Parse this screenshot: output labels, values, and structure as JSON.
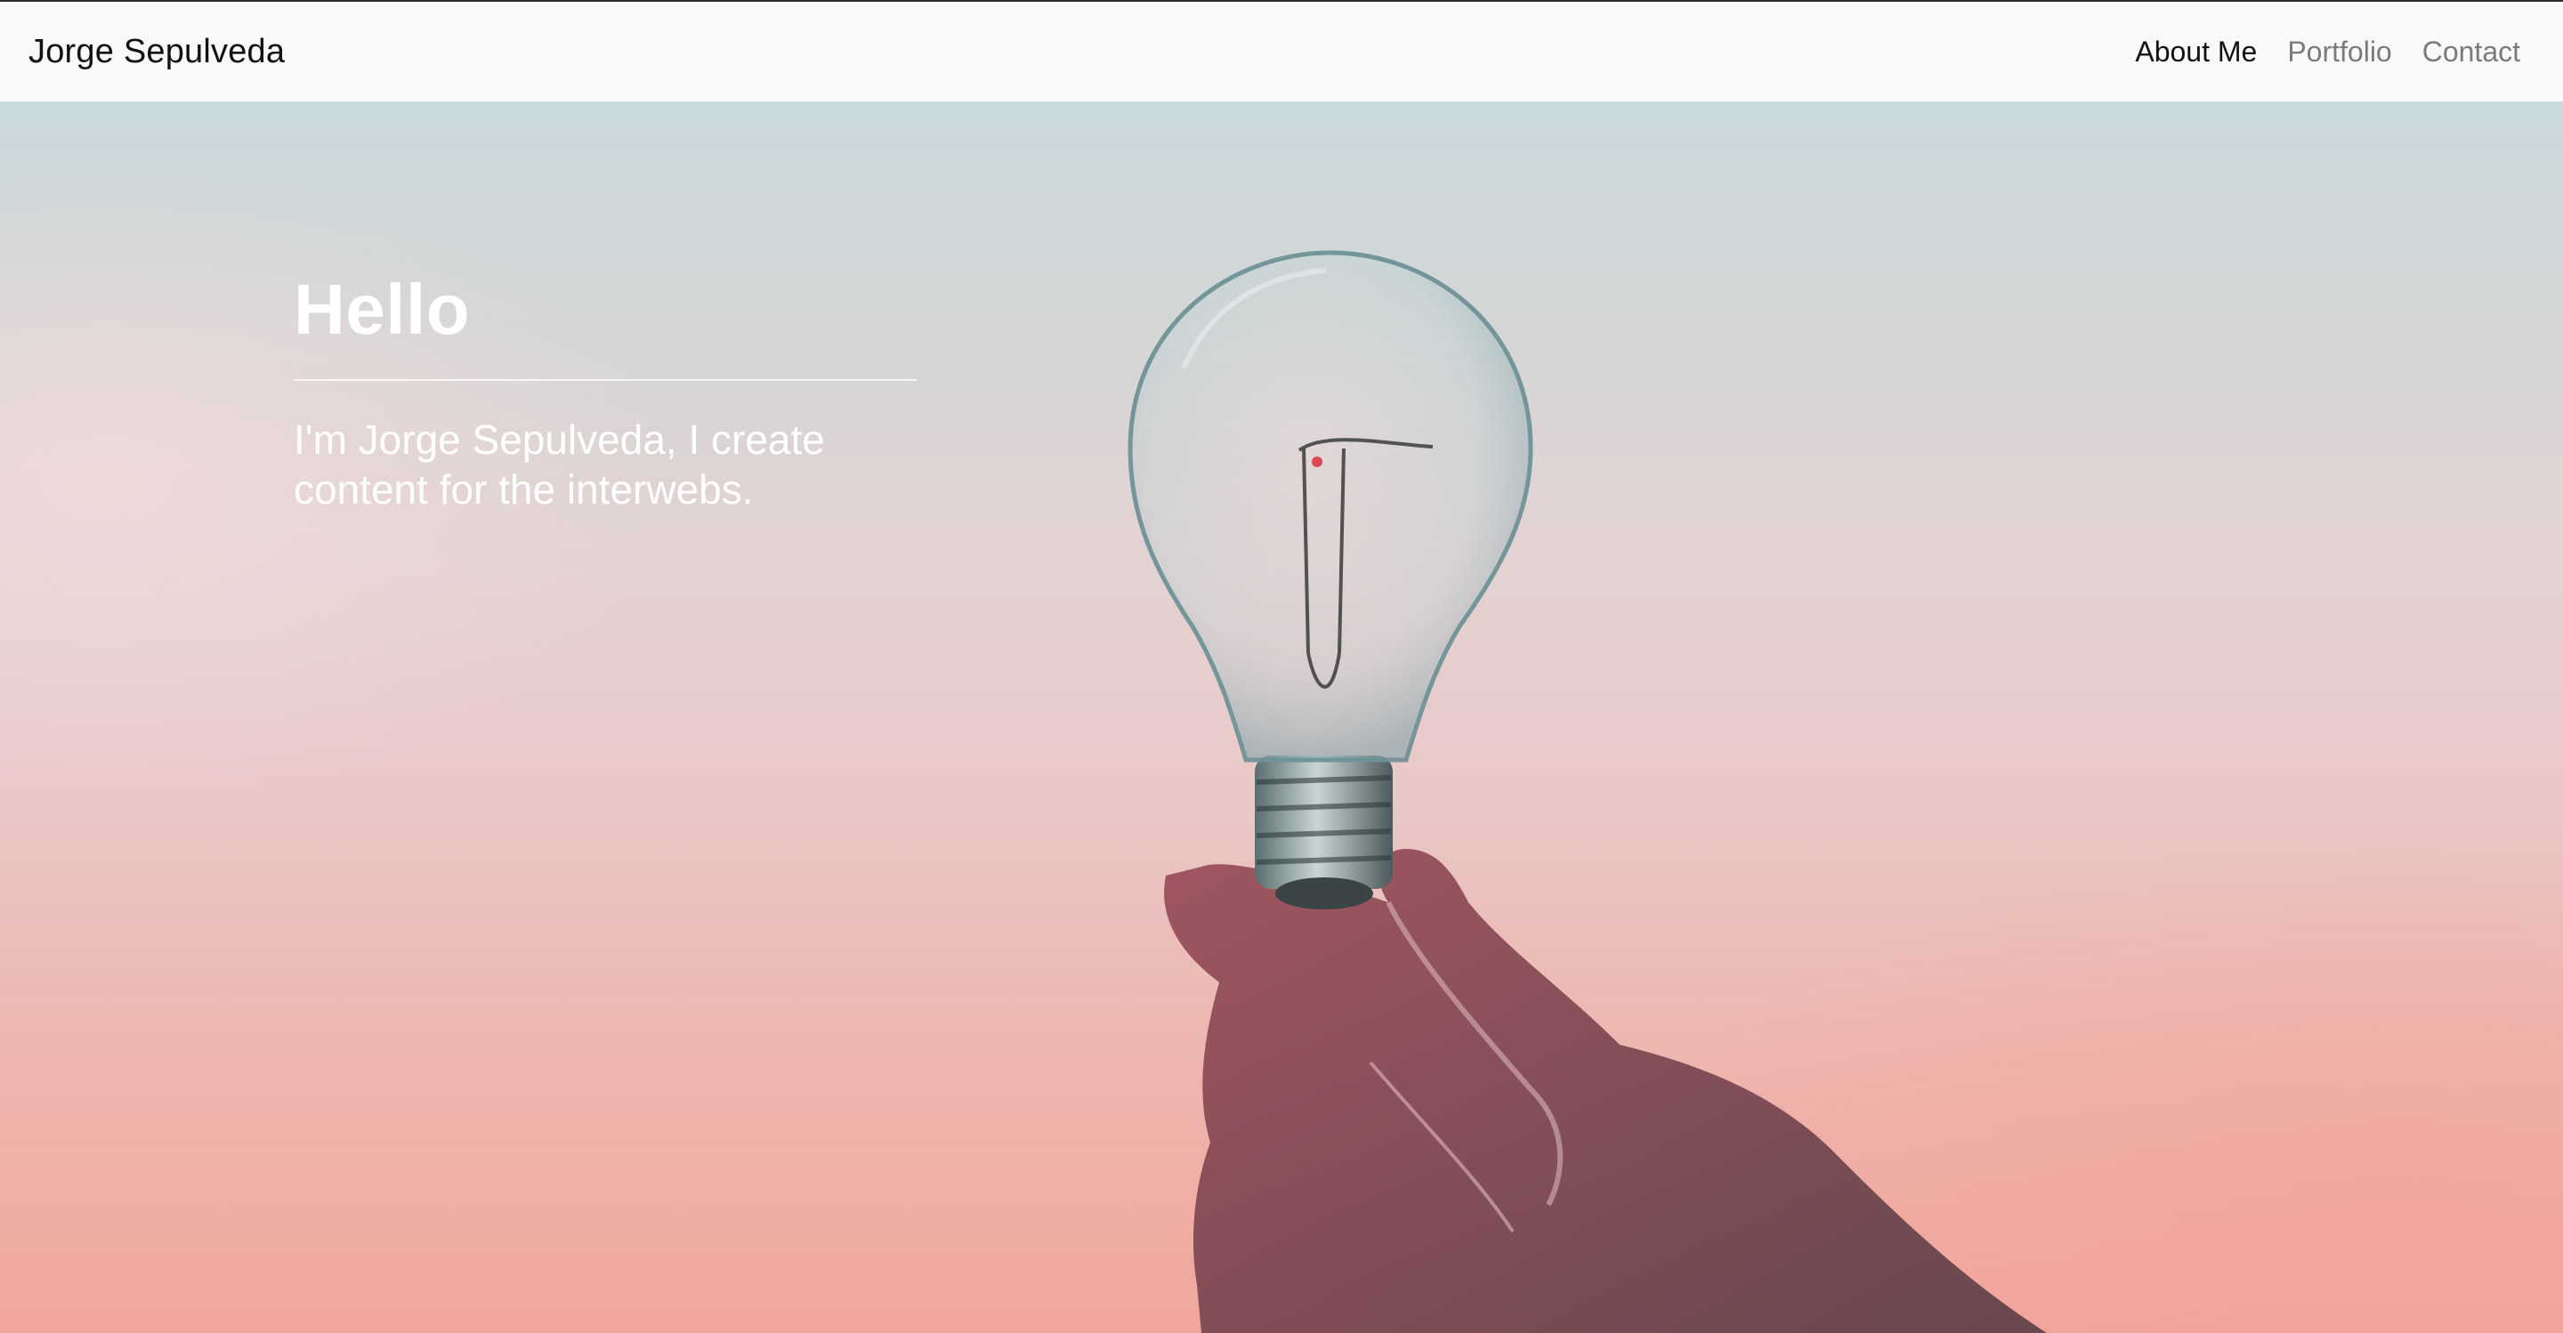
{
  "navbar": {
    "brand": "Jorge Sepulveda",
    "links": [
      {
        "label": "About Me",
        "active": true
      },
      {
        "label": "Portfolio",
        "active": false
      },
      {
        "label": "Contact",
        "active": false
      }
    ]
  },
  "hero": {
    "title": "Hello",
    "subtitle": "I'm Jorge Sepulveda, I create content for the interwebs.",
    "image_description_icon": "lightbulb-in-hand"
  },
  "colors": {
    "navbar_bg": "#f8f9fa",
    "text_dark": "#111111",
    "text_muted": "#7b7b7b",
    "hero_text": "#ffffff"
  }
}
